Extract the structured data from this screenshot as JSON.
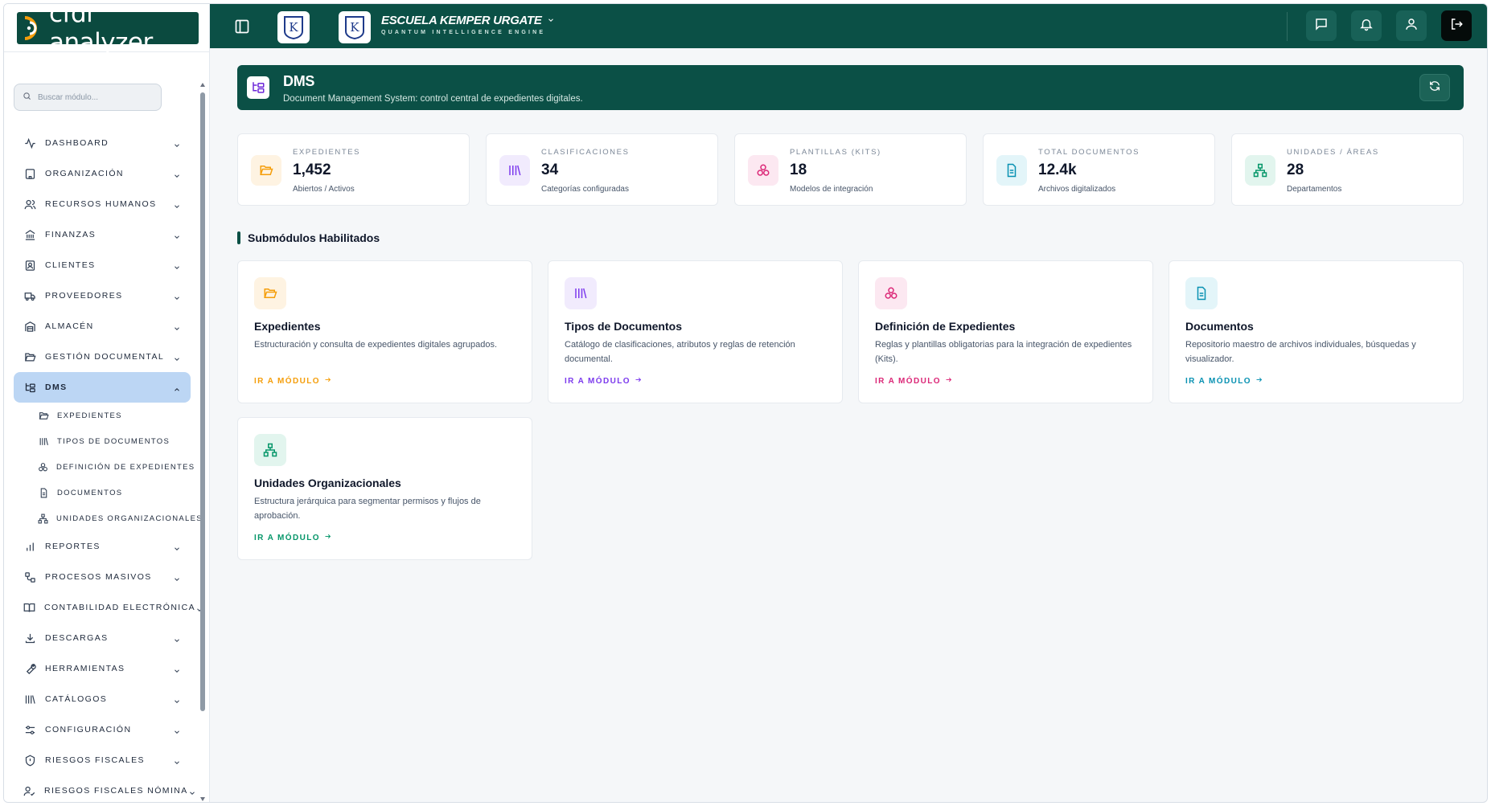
{
  "brand": {
    "name": "cfdi analyzer"
  },
  "topbar": {
    "school_name": "ESCUELA KEMPER URGATE",
    "school_tagline": "QUANTUM INTELLIGENCE ENGINE",
    "logo_letter": "K"
  },
  "sidebar": {
    "search_placeholder": "Buscar módulo...",
    "items": [
      {
        "label": "DASHBOARD",
        "icon": "activity-icon"
      },
      {
        "label": "ORGANIZACIÓN",
        "icon": "building-icon"
      },
      {
        "label": "RECURSOS HUMANOS",
        "icon": "users-icon"
      },
      {
        "label": "FINANZAS",
        "icon": "bank-icon"
      },
      {
        "label": "CLIENTES",
        "icon": "contact-icon"
      },
      {
        "label": "PROVEEDORES",
        "icon": "truck-icon"
      },
      {
        "label": "ALMACÉN",
        "icon": "warehouse-icon"
      },
      {
        "label": "GESTIÓN DOCUMENTAL",
        "icon": "folder-open-icon"
      },
      {
        "label": "DMS",
        "icon": "folder-tree-icon"
      }
    ],
    "dms_sub": [
      {
        "label": "EXPEDIENTES",
        "icon": "folder-open-icon"
      },
      {
        "label": "TIPOS DE DOCUMENTOS",
        "icon": "library-icon"
      },
      {
        "label": "DEFINICIÓN DE EXPEDIENTES",
        "icon": "boxes-icon"
      },
      {
        "label": "DOCUMENTOS",
        "icon": "file-text-icon"
      },
      {
        "label": "UNIDADES ORGANIZACIONALES",
        "icon": "network-icon"
      }
    ],
    "items_after": [
      {
        "label": "REPORTES",
        "icon": "bar-chart-icon"
      },
      {
        "label": "PROCESOS MASIVOS",
        "icon": "workflow-icon"
      },
      {
        "label": "CONTABILIDAD ELECTRÓNICA",
        "icon": "book-open-icon"
      },
      {
        "label": "DESCARGAS",
        "icon": "download-icon"
      },
      {
        "label": "HERRAMIENTAS",
        "icon": "wrench-icon"
      },
      {
        "label": "CATÁLOGOS",
        "icon": "library-icon"
      },
      {
        "label": "CONFIGURACIÓN",
        "icon": "sliders-icon"
      },
      {
        "label": "RIESGOS FISCALES",
        "icon": "shield-icon"
      },
      {
        "label": "RIESGOS FISCALES NÓMINA",
        "icon": "user-check-icon"
      }
    ]
  },
  "banner": {
    "title": "DMS",
    "subtitle": "Document Management System: control central de expedientes digitales."
  },
  "stats": [
    {
      "label": "EXPEDIENTES",
      "value": "1,452",
      "note": "Abiertos / Activos",
      "color": "#f59e0b",
      "bg": "#fef3e2",
      "icon": "folder-open-icon"
    },
    {
      "label": "CLASIFICACIONES",
      "value": "34",
      "note": "Categorías configuradas",
      "color": "#7c3aed",
      "bg": "#f1ebfd",
      "icon": "library-icon"
    },
    {
      "label": "PLANTILLAS (KITS)",
      "value": "18",
      "note": "Modelos de integración",
      "color": "#db2777",
      "bg": "#fce8f1",
      "icon": "boxes-icon"
    },
    {
      "label": "TOTAL DOCUMENTOS",
      "value": "12.4k",
      "note": "Archivos digitalizados",
      "color": "#0891b2",
      "bg": "#e3f5f9",
      "icon": "file-text-icon"
    },
    {
      "label": "UNIDADES / ÁREAS",
      "value": "28",
      "note": "Departamentos",
      "color": "#059669",
      "bg": "#e2f5ee",
      "icon": "network-icon"
    }
  ],
  "section": {
    "title": "Submódulos Habilitados"
  },
  "modules": [
    {
      "title": "Expedientes",
      "desc": "Estructuración y consulta de expedientes digitales agrupados.",
      "link": "IR A MÓDULO",
      "color": "#f59e0b",
      "bg": "#fef3e2",
      "icon": "folder-open-icon"
    },
    {
      "title": "Tipos de Documentos",
      "desc": "Catálogo de clasificaciones, atributos y reglas de retención documental.",
      "link": "IR A MÓDULO",
      "color": "#7c3aed",
      "bg": "#f1ebfd",
      "icon": "library-icon"
    },
    {
      "title": "Definición de Expedientes",
      "desc": "Reglas y plantillas obligatorias para la integración de expedientes (Kits).",
      "link": "IR A MÓDULO",
      "color": "#db2777",
      "bg": "#fce8f1",
      "icon": "boxes-icon"
    },
    {
      "title": "Documentos",
      "desc": "Repositorio maestro de archivos individuales, búsquedas y visualizador.",
      "link": "IR A MÓDULO",
      "color": "#0891b2",
      "bg": "#e3f5f9",
      "icon": "file-text-icon"
    },
    {
      "title": "Unidades Organizacionales",
      "desc": "Estructura jerárquica para segmentar permisos y flujos de aprobación.",
      "link": "IR A MÓDULO",
      "color": "#059669",
      "bg": "#e2f5ee",
      "icon": "network-icon"
    }
  ]
}
